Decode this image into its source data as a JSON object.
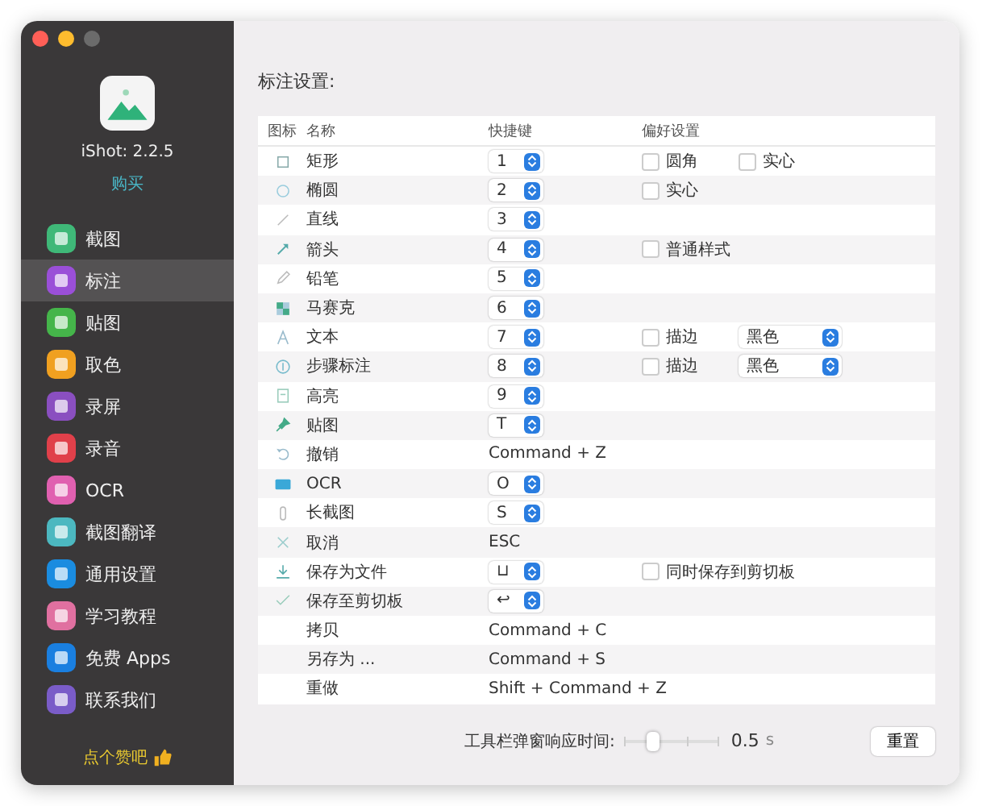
{
  "sidebar": {
    "app_name": "iShot: 2.2.5",
    "buy_link": "购买",
    "items": [
      {
        "label": "截图",
        "color": "#3fb878",
        "selected": false
      },
      {
        "label": "标注",
        "color": "#9a4fd8",
        "selected": true
      },
      {
        "label": "贴图",
        "color": "#45b54a",
        "selected": false
      },
      {
        "label": "取色",
        "color": "#f0a020",
        "selected": false
      },
      {
        "label": "录屏",
        "color": "#8a4fc0",
        "selected": false
      },
      {
        "label": "录音",
        "color": "#e0404a",
        "selected": false
      },
      {
        "label": "OCR",
        "color": "#e060b0",
        "selected": false
      },
      {
        "label": "截图翻译",
        "color": "#4cb8c0",
        "selected": false
      },
      {
        "label": "通用设置",
        "color": "#1a8ce0",
        "selected": false
      },
      {
        "label": "学习教程",
        "color": "#e070a0",
        "selected": false
      },
      {
        "label": "免费 Apps",
        "color": "#1a7fe0",
        "selected": false
      },
      {
        "label": "联系我们",
        "color": "#7a5cc8",
        "selected": false
      }
    ],
    "footer": "点个赞吧"
  },
  "main": {
    "title": "标注设置:",
    "table": {
      "columns": [
        "图标",
        "名称",
        "快捷键",
        "偏好设置"
      ],
      "rows": [
        {
          "name": "矩形",
          "shortcut": {
            "kind": "select",
            "value": "1"
          },
          "prefs": [
            {
              "kind": "checkbox",
              "label": "圆角",
              "checked": false
            },
            {
              "kind": "checkbox",
              "label": "实心",
              "checked": false
            }
          ]
        },
        {
          "name": "椭圆",
          "shortcut": {
            "kind": "select",
            "value": "2"
          },
          "prefs": [
            {
              "kind": "checkbox",
              "label": "实心",
              "checked": false
            }
          ]
        },
        {
          "name": "直线",
          "shortcut": {
            "kind": "select",
            "value": "3"
          },
          "prefs": []
        },
        {
          "name": "箭头",
          "shortcut": {
            "kind": "select",
            "value": "4"
          },
          "prefs": [
            {
              "kind": "checkbox",
              "label": "普通样式",
              "checked": false
            }
          ]
        },
        {
          "name": "铅笔",
          "shortcut": {
            "kind": "select",
            "value": "5"
          },
          "prefs": []
        },
        {
          "name": "马赛克",
          "shortcut": {
            "kind": "select",
            "value": "6"
          },
          "prefs": []
        },
        {
          "name": "文本",
          "shortcut": {
            "kind": "select",
            "value": "7"
          },
          "prefs": [
            {
              "kind": "checkbox",
              "label": "描边",
              "checked": false
            },
            {
              "kind": "select",
              "value": "黑色"
            }
          ]
        },
        {
          "name": "步骤标注",
          "shortcut": {
            "kind": "select",
            "value": "8"
          },
          "prefs": [
            {
              "kind": "checkbox",
              "label": "描边",
              "checked": false
            },
            {
              "kind": "select",
              "value": "黑色"
            }
          ]
        },
        {
          "name": "高亮",
          "shortcut": {
            "kind": "select",
            "value": "9"
          },
          "prefs": []
        },
        {
          "name": "贴图",
          "shortcut": {
            "kind": "select",
            "value": "T"
          },
          "prefs": []
        },
        {
          "name": "撤销",
          "shortcut": {
            "kind": "text",
            "value": "Command + Z"
          },
          "prefs": []
        },
        {
          "name": "OCR",
          "shortcut": {
            "kind": "select",
            "value": "O"
          },
          "prefs": []
        },
        {
          "name": "长截图",
          "shortcut": {
            "kind": "select",
            "value": "S"
          },
          "prefs": []
        },
        {
          "name": "取消",
          "shortcut": {
            "kind": "text",
            "value": "ESC"
          },
          "prefs": []
        },
        {
          "name": "保存为文件",
          "shortcut": {
            "kind": "select",
            "value": "⊔"
          },
          "prefs": [
            {
              "kind": "checkbox",
              "label": "同时保存到剪切板",
              "checked": false
            }
          ]
        },
        {
          "name": "保存至剪切板",
          "shortcut": {
            "kind": "select",
            "value": "↩"
          },
          "prefs": []
        },
        {
          "name": "拷贝",
          "shortcut": {
            "kind": "text",
            "value": "Command + C"
          },
          "prefs": []
        },
        {
          "name": "另存为 ...",
          "shortcut": {
            "kind": "text",
            "value": "Command + S"
          },
          "prefs": []
        },
        {
          "name": "重做",
          "shortcut": {
            "kind": "text",
            "value": "Shift + Command + Z"
          },
          "prefs": []
        }
      ]
    },
    "delay": {
      "label": "工具栏弹窗响应时间:",
      "level": 0.3,
      "value": "0.5",
      "unit": "s"
    },
    "reset_button": "重置"
  }
}
